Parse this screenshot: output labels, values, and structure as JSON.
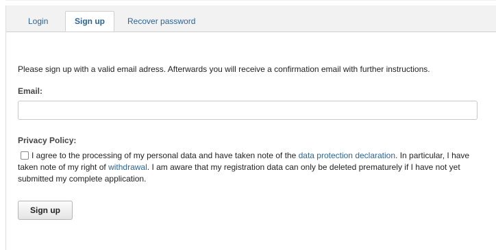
{
  "tabs": {
    "login": "Login",
    "signup": "Sign up",
    "recover": "Recover password"
  },
  "intro_text": "Please sign up with a valid email adress. Afterwards you will receive a confirmation email with further instructions.",
  "email": {
    "label": "Email:",
    "value": "",
    "placeholder": ""
  },
  "privacy": {
    "label": "Privacy Policy:",
    "checked": false,
    "text_1": "I agree to the processing of my personal data and have taken note of the ",
    "link_1": "data protection declaration",
    "text_2": ". In particular, I have taken note of my right of ",
    "link_2": "withdrawal",
    "text_3": ". I am aware that my registration data can only be deleted prematurely if I have not yet submitted my complete application."
  },
  "signup_button": "Sign up",
  "colors": {
    "link": "#2a6496",
    "tab_bar": "#f2f2f2"
  }
}
